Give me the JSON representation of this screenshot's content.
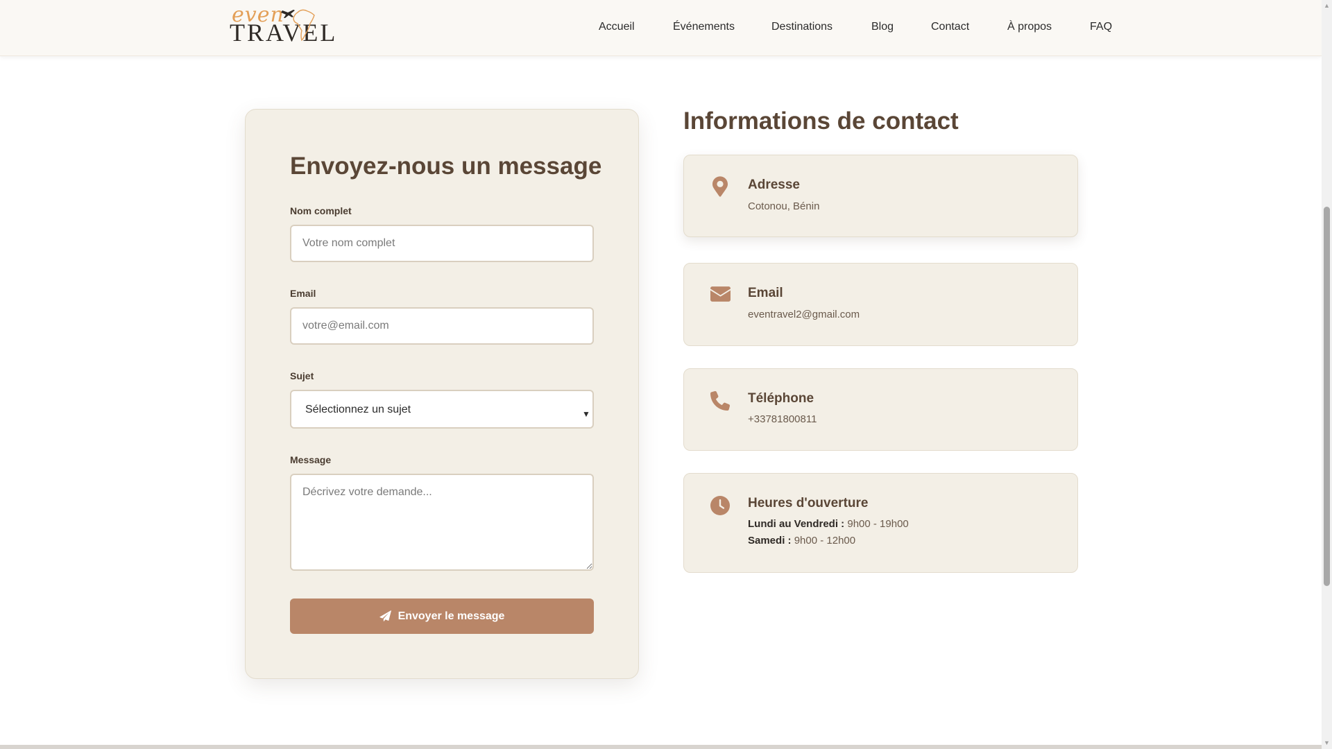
{
  "brand": {
    "logo_top": "even",
    "logo_bottom": "TRAVEL",
    "accent_color": "#e39f57"
  },
  "nav": {
    "items": [
      "Accueil",
      "Événements",
      "Destinations",
      "Blog",
      "Contact",
      "À propos",
      "FAQ"
    ]
  },
  "form": {
    "title": "Envoyez-nous un message",
    "name_label": "Nom complet",
    "name_placeholder": "Votre nom complet",
    "email_label": "Email",
    "email_placeholder": "votre@email.com",
    "subject_label": "Sujet",
    "subject_selected": "Sélectionnez un sujet",
    "message_label": "Message",
    "message_placeholder": "Décrivez votre demande...",
    "submit_label": "Envoyer le message",
    "submit_icon": "paper-plane-icon",
    "button_color": "#b98668"
  },
  "contact_info": {
    "title": "Informations de contact",
    "address": {
      "icon": "map-pin-icon",
      "heading": "Adresse",
      "value": "Cotonou, Bénin"
    },
    "email": {
      "icon": "envelope-icon",
      "heading": "Email",
      "value": "eventravel2@gmail.com"
    },
    "phone": {
      "icon": "phone-icon",
      "heading": "Téléphone",
      "value": "+33781800811"
    },
    "hours": {
      "icon": "clock-icon",
      "heading": "Heures d'ouverture",
      "weekdays_label": "Lundi au Vendredi :",
      "weekdays_value": "9h00 - 19h00",
      "saturday_label": "Samedi :",
      "saturday_value": "9h00 - 12h00"
    },
    "icon_color": "#b98668"
  }
}
